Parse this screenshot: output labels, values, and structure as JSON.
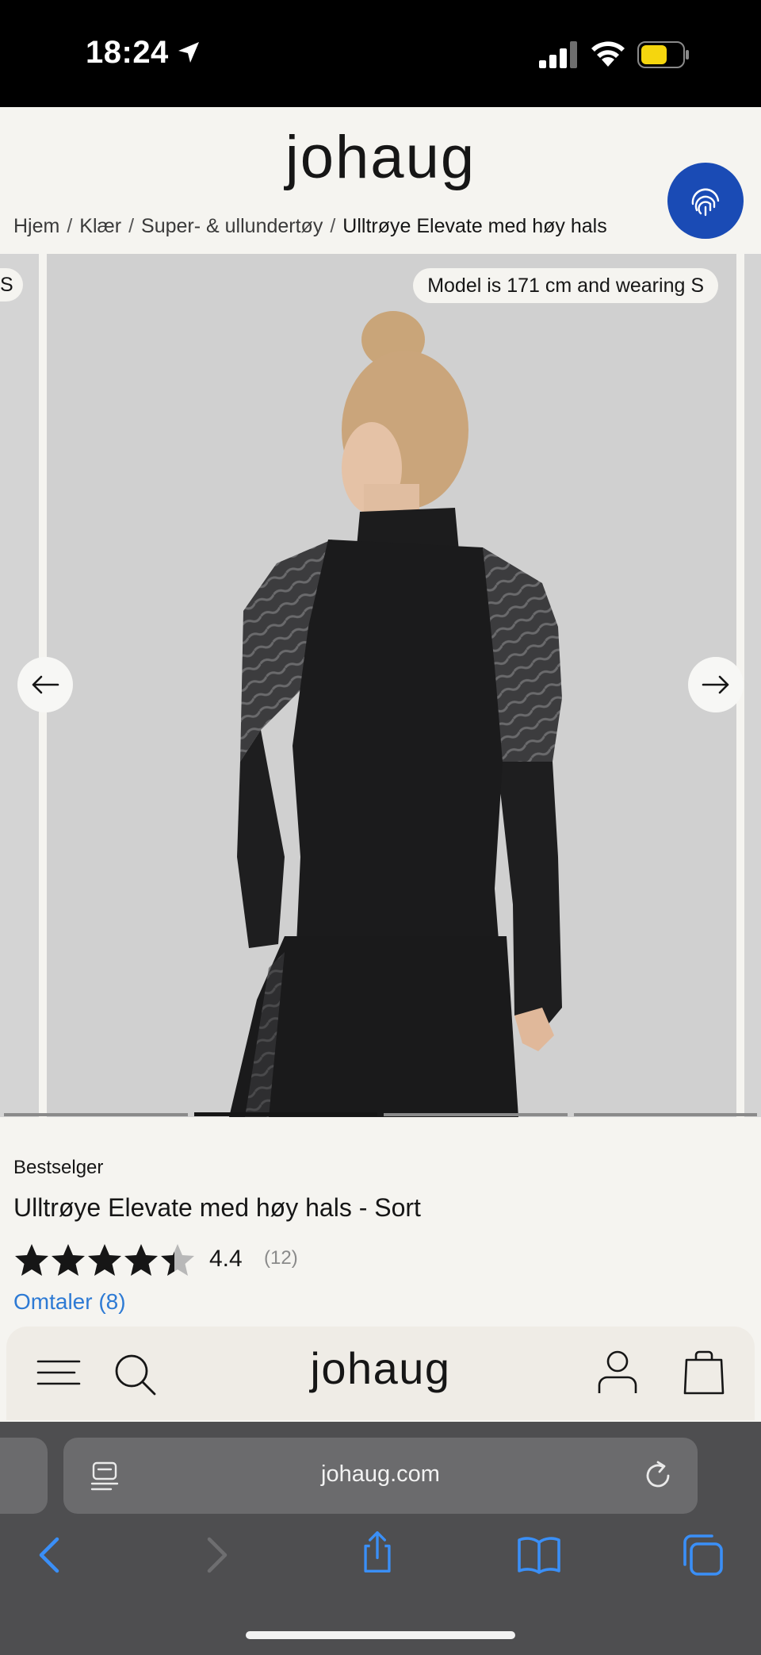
{
  "status_bar": {
    "time": "18:24",
    "icons": [
      "location-arrow-icon",
      "cellular-signal-icon",
      "wifi-icon",
      "battery-icon"
    ],
    "battery_color": "#f5d60e"
  },
  "header": {
    "logo": "johaug",
    "fingerprint_button_color": "#1a4bb5",
    "breadcrumb": [
      "Hjem",
      "Klær",
      "Super- & ullundertøy",
      "Ulltrøye Elevate med høy hals"
    ],
    "breadcrumb_separator": "/"
  },
  "gallery": {
    "prev_slide_badge": "S",
    "model_badge": "Model is 171 cm and wearing S",
    "slide_count": 4,
    "active_slide": 2
  },
  "product": {
    "badge": "Bestselger",
    "title": "Ulltrøye Elevate med høy hals - Sort",
    "rating": 4.4,
    "rating_display": "4.4",
    "rating_count": "(12)",
    "reviews_link": "Omtaler (8)"
  },
  "bottom_nav": {
    "logo": "johaug",
    "icons": [
      "menu-icon",
      "search-icon",
      "account-icon",
      "bag-icon"
    ]
  },
  "safari": {
    "url": "johaug.com",
    "toolbar": [
      "back-icon",
      "forward-icon",
      "share-icon",
      "bookmarks-icon",
      "tabs-icon"
    ],
    "accent_color": "#3a8ff7"
  }
}
